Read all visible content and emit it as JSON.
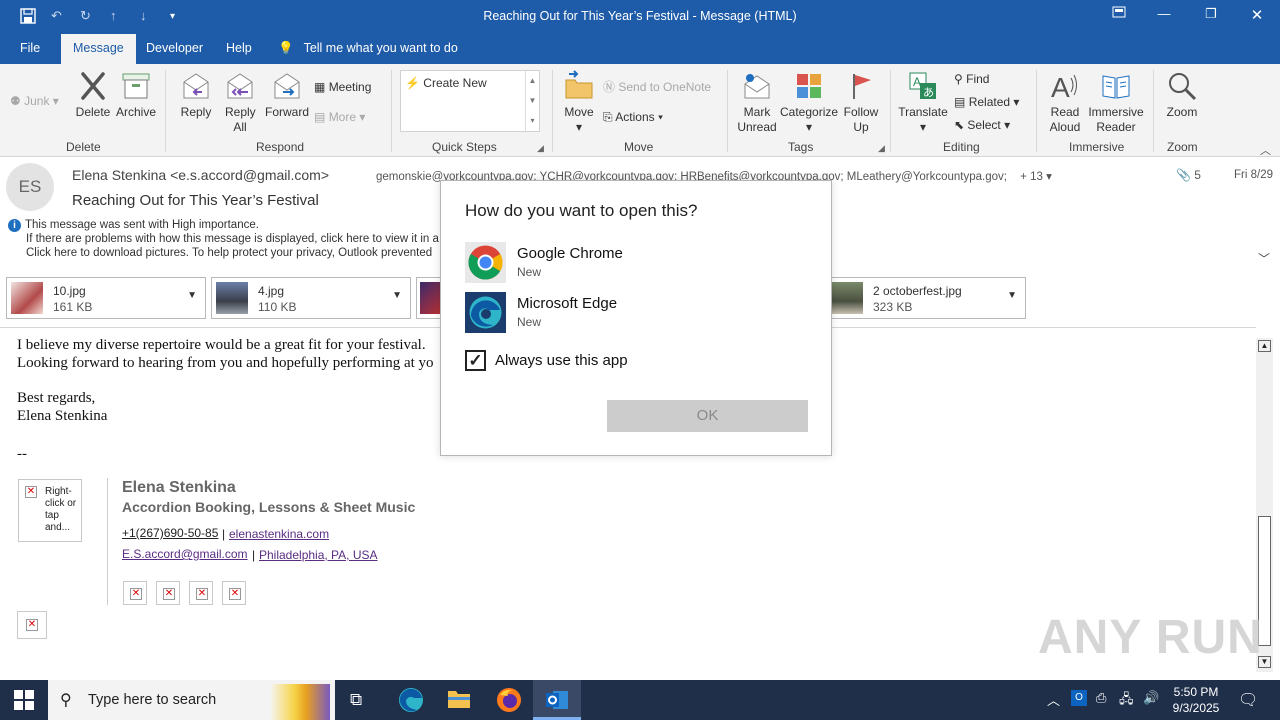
{
  "window": {
    "title": "Reaching Out for This Year’s Festival  -  Message (HTML)"
  },
  "tabs": [
    {
      "label": "File"
    },
    {
      "label": "Message"
    },
    {
      "label": "Developer"
    },
    {
      "label": "Help"
    }
  ],
  "tell_me": "Tell me what you want to do",
  "ribbon": {
    "junk": "Junk",
    "delete": "Delete",
    "archive": "Archive",
    "reply": "Reply",
    "reply_all": "Reply All",
    "forward": "Forward",
    "meeting": "Meeting",
    "more": "More",
    "create_new": "Create New",
    "move": "Move",
    "send_onenote": "Send to OneNote",
    "actions": "Actions",
    "mark_unread": "Mark Unread",
    "categorize": "Categorize",
    "follow_up": "Follow Up",
    "translate": "Translate",
    "find": "Find",
    "related": "Related",
    "select": "Select",
    "read_aloud": "Read Aloud",
    "immersive_reader": "Immersive Reader",
    "zoom": "Zoom",
    "groups": [
      "Delete",
      "Respond",
      "Quick Steps",
      "Move",
      "Tags",
      "Editing",
      "Immersive",
      "Zoom"
    ]
  },
  "message": {
    "avatar": "ES",
    "sender": "Elena Stenkina <e.s.accord@gmail.com>",
    "recipients": "gemonskie@yorkcountypa.gov; YCHR@yorkcountypa.gov; HRBenefits@yorkcountypa.gov; MLeathery@Yorkcountypa.gov;",
    "more_recipients": "+ 13",
    "attachment_count": "5",
    "date": "Fri 8/29",
    "subject": "Reaching Out for This Year’s Festival",
    "info1": "This message was sent with High importance.",
    "info2": "If there are problems with how this message is displayed, click here to view it in a",
    "info3": "Click here to download pictures. To help protect your privacy, Outlook prevented"
  },
  "attachments": [
    {
      "name": "10.jpg",
      "size": "161 KB"
    },
    {
      "name": "4.jpg",
      "size": "110 KB"
    },
    {
      "name": "2 octoberfest.jpg",
      "size": "323 KB"
    }
  ],
  "body": {
    "line1": "I believe my diverse repertoire would be a great fit for your festival.",
    "line2": "Looking forward to hearing from you and hopefully performing at yo",
    "line3": "Best regards,",
    "line4": "Elena Stenkina",
    "line5": "--"
  },
  "signature": {
    "image_alt": "Right-click or tap and...",
    "name": "Elena Stenkina",
    "tagline": "Accordion Booking, Lessons & Sheet Music",
    "phone": "+1(267)690-50-85",
    "website": "elenastenkina.com",
    "email": "E.S.accord@gmail.com",
    "location": "Philadelphia, PA, USA",
    "sep": "|"
  },
  "dialog": {
    "title": "How do you want to open this?",
    "apps": [
      {
        "name": "Google Chrome",
        "status": "New"
      },
      {
        "name": "Microsoft Edge",
        "status": "New"
      }
    ],
    "always_label": "Always use this app",
    "ok_label": "OK"
  },
  "watermark": "ANY RUN",
  "taskbar": {
    "search_placeholder": "Type here to search",
    "time": "5:50 PM",
    "date": "9/3/2025"
  }
}
